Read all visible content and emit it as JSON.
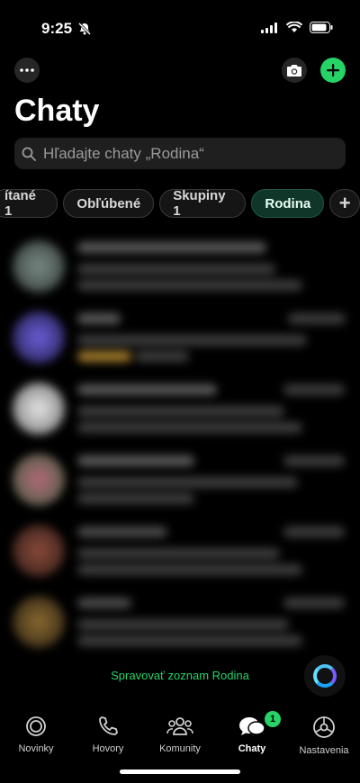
{
  "status": {
    "time": "9:25"
  },
  "header": {
    "title": "Chaty"
  },
  "search": {
    "placeholder": "Hľadajte chaty „Rodina“"
  },
  "filters": [
    {
      "label": "ítané 1",
      "active": false
    },
    {
      "label": "Obľúbené",
      "active": false
    },
    {
      "label": "Skupiny 1",
      "active": false
    },
    {
      "label": "Rodina",
      "active": true
    },
    {
      "label": "+",
      "active": false
    }
  ],
  "list": {
    "manage_label": "Spravovať zoznam Rodina"
  },
  "tabs": [
    {
      "label": "Novinky",
      "icon": "updates-icon"
    },
    {
      "label": "Hovory",
      "icon": "phone-icon"
    },
    {
      "label": "Komunity",
      "icon": "communities-icon"
    },
    {
      "label": "Chaty",
      "icon": "chats-icon",
      "badge": "1"
    },
    {
      "label": "Nastavenia",
      "icon": "settings-icon"
    }
  ],
  "colors": {
    "accent": "#25d366",
    "background": "#000000"
  }
}
